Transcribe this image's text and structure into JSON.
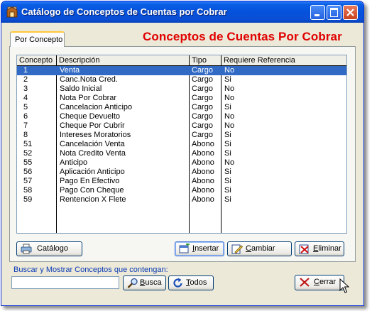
{
  "window": {
    "title": "Catálogo de Conceptos de Cuentas por Cobrar"
  },
  "tab": {
    "label": "Por Concepto"
  },
  "banner": "Conceptos de Cuentas Por Cobrar",
  "grid": {
    "columns": [
      "Concepto",
      "Descripción",
      "Tipo",
      "Requiere Referencia"
    ],
    "selected_index": 0,
    "rows": [
      {
        "concepto": "1",
        "descripcion": "Venta",
        "tipo": "Cargo",
        "referencia": "No"
      },
      {
        "concepto": "2",
        "descripcion": "Canc.Nota Cred.",
        "tipo": "Cargo",
        "referencia": "Si"
      },
      {
        "concepto": "3",
        "descripcion": "Saldo Inicial",
        "tipo": "Cargo",
        "referencia": "No"
      },
      {
        "concepto": "4",
        "descripcion": "Nota Por Cobrar",
        "tipo": "Cargo",
        "referencia": "No"
      },
      {
        "concepto": "5",
        "descripcion": "Cancelacion Anticipo",
        "tipo": "Cargo",
        "referencia": "Si"
      },
      {
        "concepto": "6",
        "descripcion": "Cheque Devuelto",
        "tipo": "Cargo",
        "referencia": "No"
      },
      {
        "concepto": "7",
        "descripcion": "Cheque Por Cubrir",
        "tipo": "Cargo",
        "referencia": "No"
      },
      {
        "concepto": "8",
        "descripcion": "Intereses Moratorios",
        "tipo": "Cargo",
        "referencia": "Si"
      },
      {
        "concepto": "51",
        "descripcion": "Cancelación Venta",
        "tipo": "Abono",
        "referencia": "Si"
      },
      {
        "concepto": "52",
        "descripcion": "Nota Credito Venta",
        "tipo": "Abono",
        "referencia": "Si"
      },
      {
        "concepto": "55",
        "descripcion": "Anticipo",
        "tipo": "Abono",
        "referencia": "No"
      },
      {
        "concepto": "56",
        "descripcion": "Aplicación Anticipo",
        "tipo": "Abono",
        "referencia": "Si"
      },
      {
        "concepto": "57",
        "descripcion": "Pago En Efectivo",
        "tipo": "Abono",
        "referencia": "Si"
      },
      {
        "concepto": "58",
        "descripcion": "Pago Con Cheque",
        "tipo": "Abono",
        "referencia": "Si"
      },
      {
        "concepto": "59",
        "descripcion": "Rentencion X Flete",
        "tipo": "Abono",
        "referencia": "Si"
      }
    ]
  },
  "buttons": {
    "catalogo": "Catálogo",
    "insertar_u": "I",
    "insertar_rest": "nsertar",
    "cambiar_u": "C",
    "cambiar_rest": "ambiar",
    "eliminar_u": "E",
    "eliminar_rest": "liminar",
    "busca_u": "B",
    "busca_rest": "usca",
    "todos_u": "T",
    "todos_rest": "odos",
    "cerrar_u": "C",
    "cerrar_rest": "errar"
  },
  "search": {
    "label": "Buscar y Mostrar Conceptos que contengan:",
    "value": ""
  },
  "colors": {
    "title_bar": "#0551dc",
    "banner": "#e00000",
    "selection": "#316ac5",
    "search_label": "#0a3bb5"
  }
}
